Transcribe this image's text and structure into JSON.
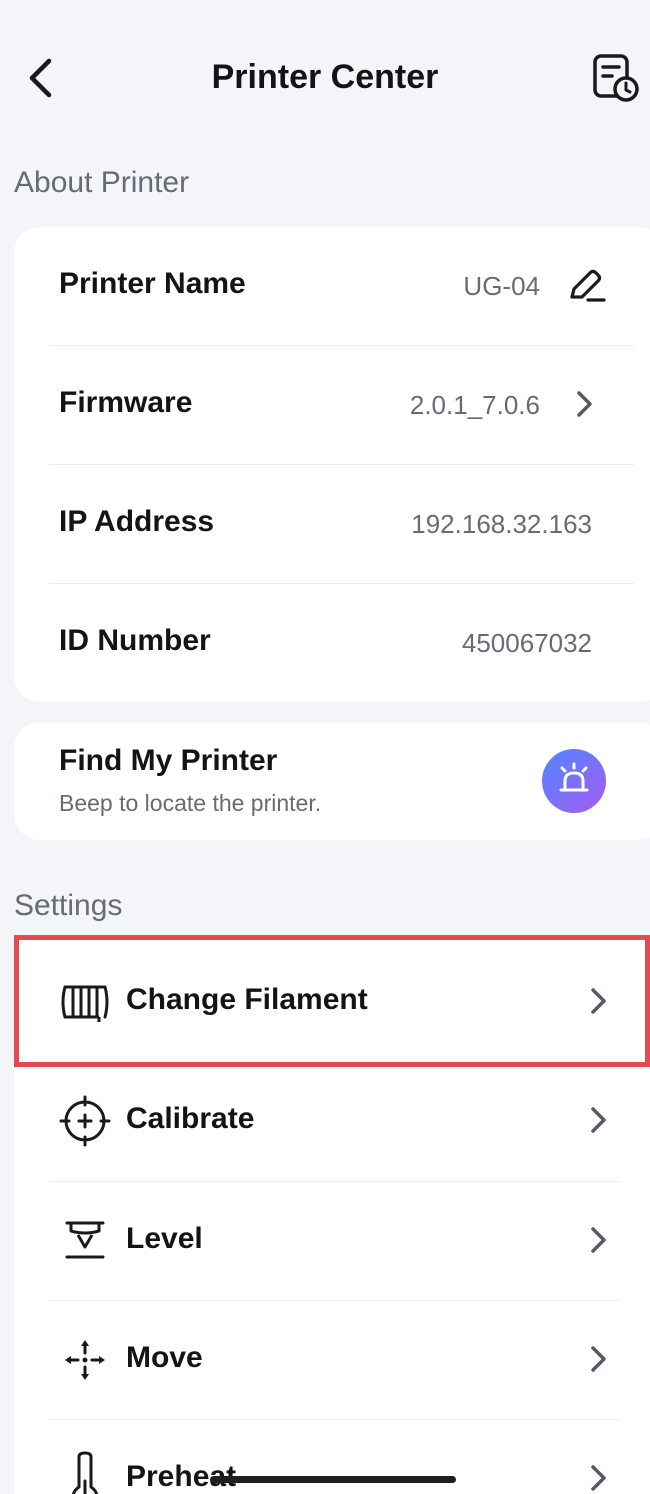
{
  "header": {
    "title": "Printer Center"
  },
  "about": {
    "section_title": "About Printer",
    "rows": [
      {
        "label": "Printer Name",
        "value": "UG-04"
      },
      {
        "label": "Firmware",
        "value": "2.0.1_7.0.6"
      },
      {
        "label": "IP Address",
        "value": "192.168.32.163"
      },
      {
        "label": "ID Number",
        "value": "450067032"
      }
    ]
  },
  "find": {
    "title": "Find My Printer",
    "subtitle": "Beep to locate the printer."
  },
  "settings": {
    "section_title": "Settings",
    "items": [
      {
        "label": "Change Filament",
        "icon": "filament-icon"
      },
      {
        "label": "Calibrate",
        "icon": "crosshair-icon"
      },
      {
        "label": "Level",
        "icon": "level-icon"
      },
      {
        "label": "Move",
        "icon": "move-icon"
      },
      {
        "label": "Preheat",
        "icon": "thermometer-icon"
      }
    ]
  },
  "colors": {
    "background": "#f3f5f9",
    "highlight": "#e5484d",
    "alarm_gradient_start": "#4f86ff",
    "alarm_gradient_end": "#a45cf0"
  }
}
